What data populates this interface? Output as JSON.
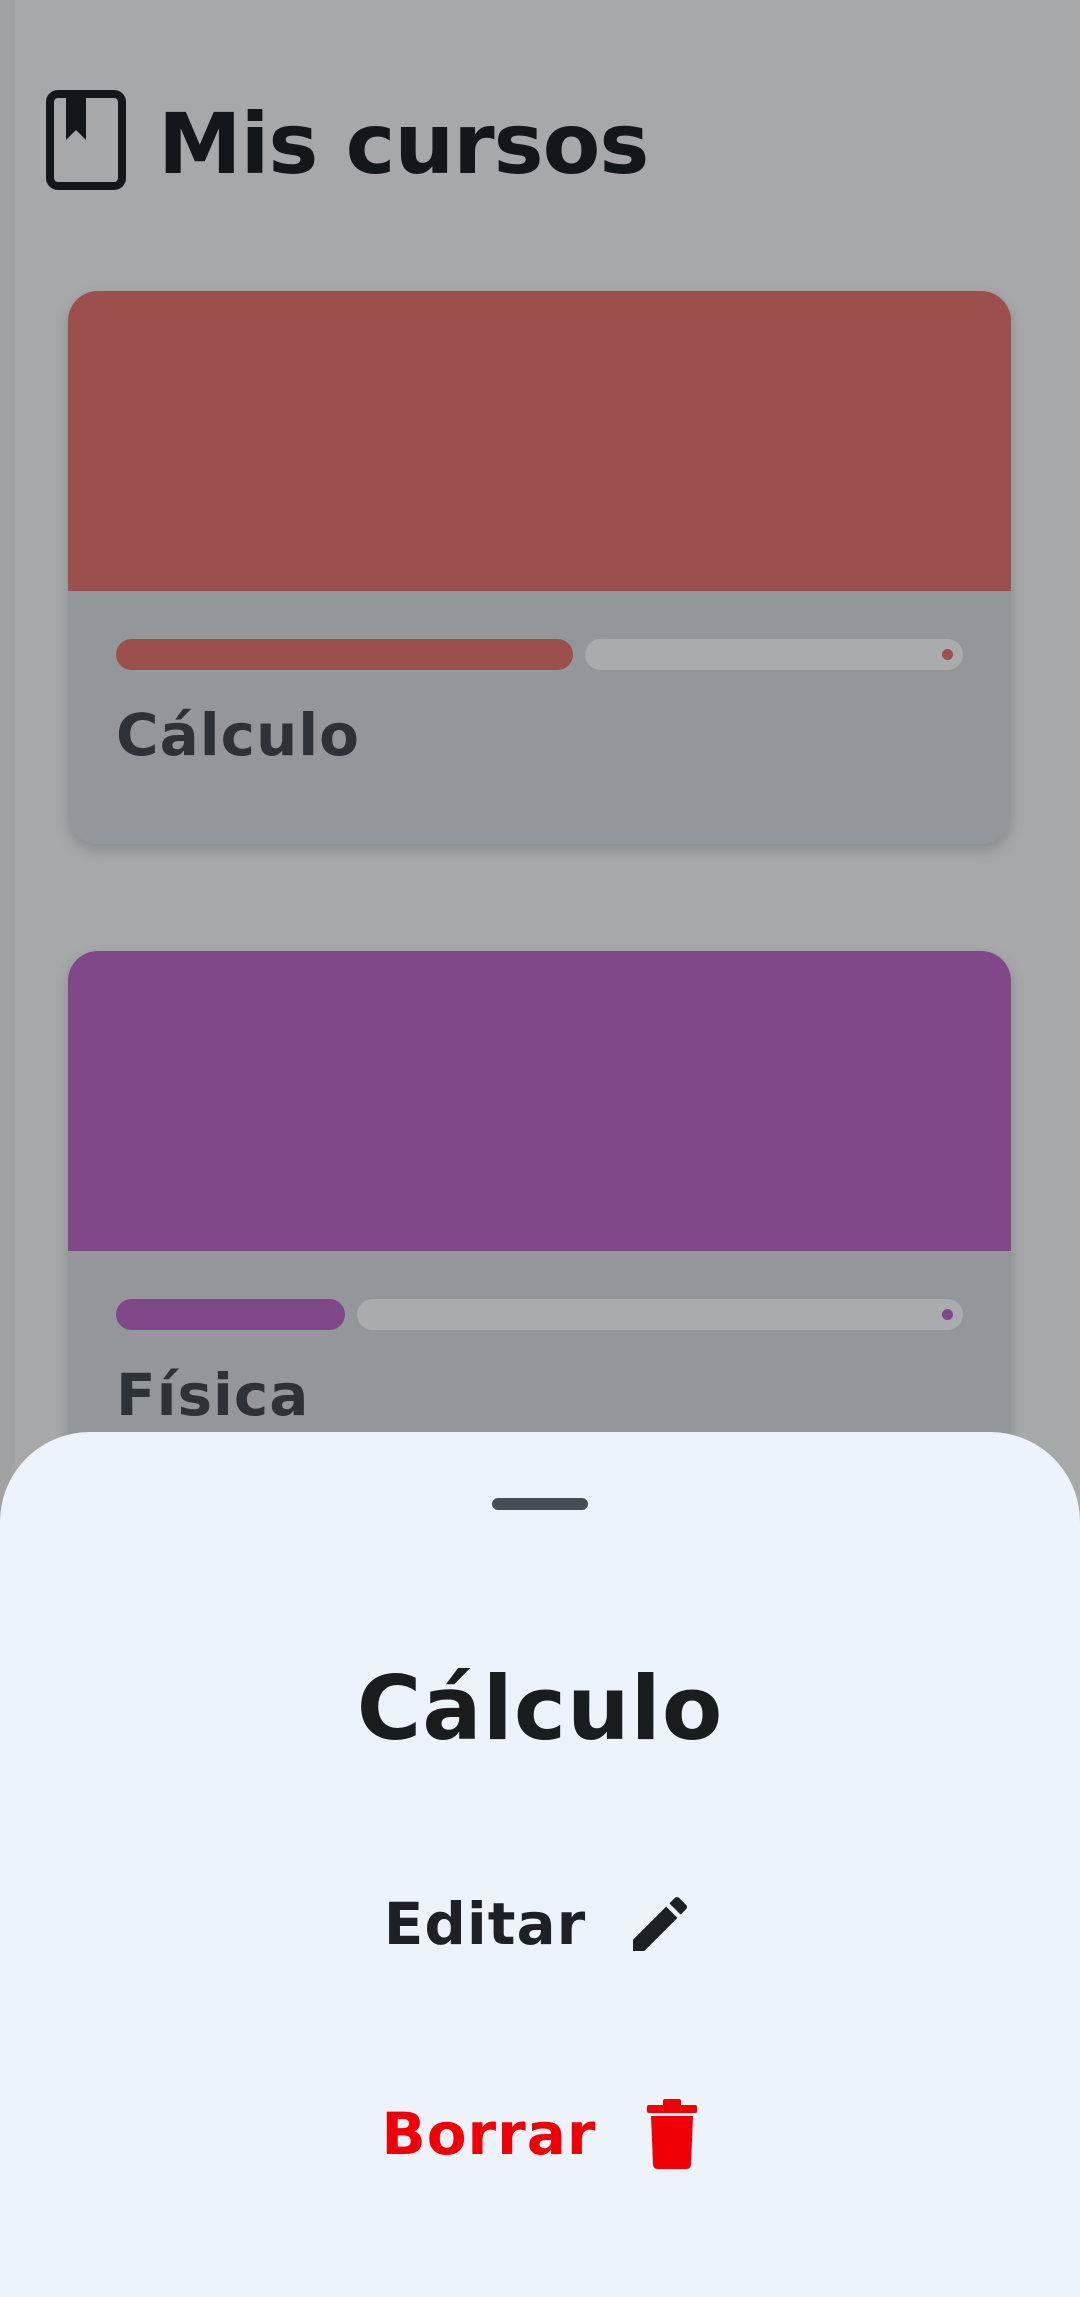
{
  "header": {
    "title": "Mis cursos",
    "icon": "bookmark-book-icon"
  },
  "courses": [
    {
      "name": "Cálculo",
      "color": "#9b504e",
      "progress": 0.54
    },
    {
      "name": "Física",
      "color": "#7e4889",
      "progress": 0.27
    }
  ],
  "sheet": {
    "title": "Cálculo",
    "edit_label": "Editar",
    "edit_icon": "pencil-icon",
    "delete_label": "Borrar",
    "delete_icon": "trash-icon",
    "delete_color": "#f00006"
  },
  "colors": {
    "scrim": "#a6a8aa",
    "sheet_bg": "#ecf3fb"
  }
}
